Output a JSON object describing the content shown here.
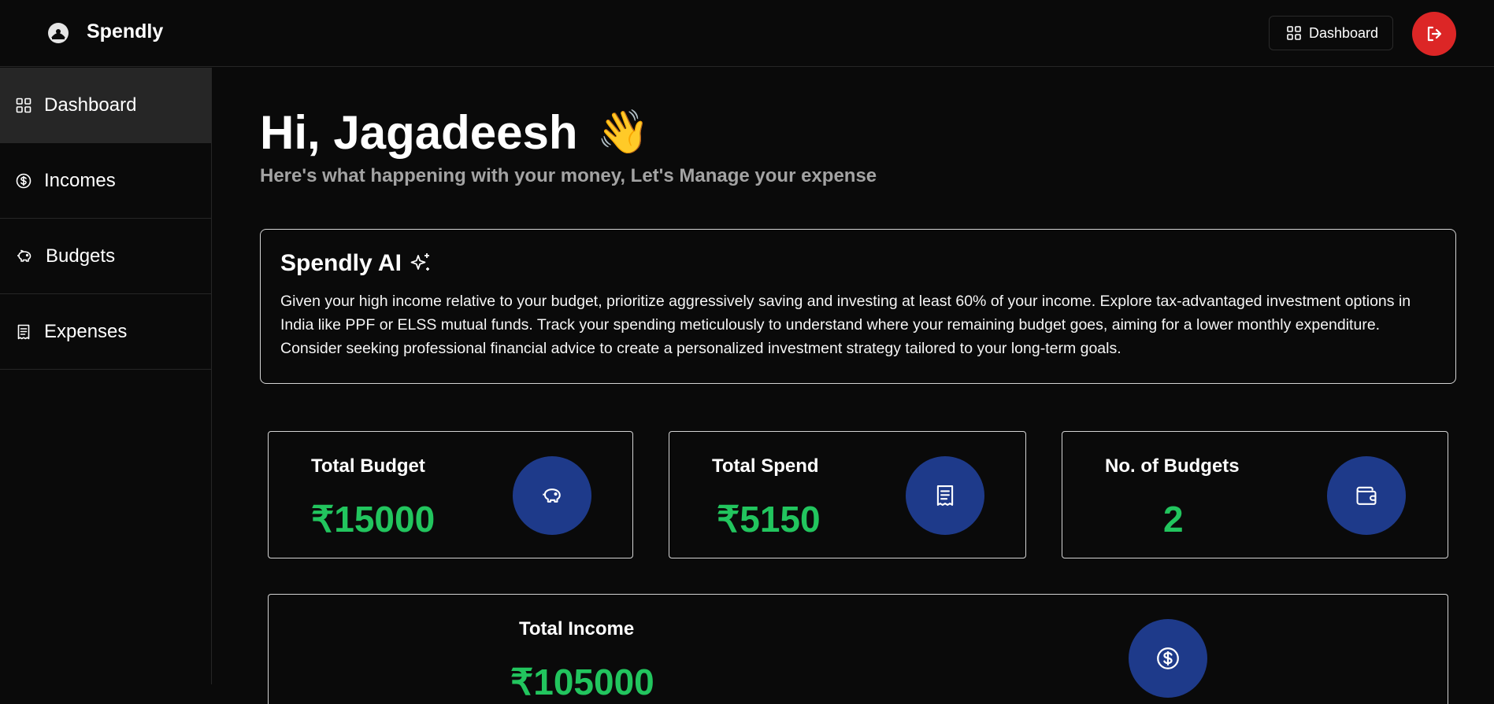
{
  "header": {
    "brand": "Spendly",
    "dashboard_button": "Dashboard"
  },
  "sidebar": {
    "items": [
      {
        "label": "Dashboard",
        "icon": "grid-icon",
        "active": true
      },
      {
        "label": "Incomes",
        "icon": "dollar-circle-icon"
      },
      {
        "label": "Budgets",
        "icon": "piggy-bank-icon"
      },
      {
        "label": "Expenses",
        "icon": "receipt-icon"
      }
    ]
  },
  "main": {
    "greeting": "Hi, Jagadeesh",
    "greeting_emoji": "👋",
    "subtitle": "Here's what happening with your money, Let's Manage your expense",
    "ai": {
      "title": "Spendly AI",
      "text": "Given your high income relative to your budget, prioritize aggressively saving and investing at least 60% of your income. Explore tax-advantaged investment options in India like PPF or ELSS mutual funds. Track your spending meticulously to understand where your remaining budget goes, aiming for a lower monthly expenditure. Consider seeking professional financial advice to create a personalized investment strategy tailored to your long-term goals."
    },
    "stats": {
      "total_budget": {
        "label": "Total Budget",
        "value": "₹15000",
        "icon": "piggy-bank-icon"
      },
      "total_spend": {
        "label": "Total Spend",
        "value": "₹5150",
        "icon": "receipt-icon"
      },
      "num_budgets": {
        "label": "No. of Budgets",
        "value": "2",
        "icon": "wallet-icon"
      },
      "total_income": {
        "label": "Total Income",
        "value": "₹105000",
        "icon": "dollar-circle-icon"
      }
    }
  },
  "colors": {
    "background": "#0a0a0a",
    "accent_green": "#22c55e",
    "icon_circle": "#1e3a8a",
    "logout_red": "#dc2626",
    "sidebar_active": "#262626"
  }
}
